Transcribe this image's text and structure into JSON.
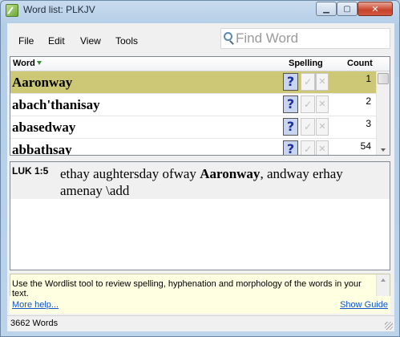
{
  "window": {
    "title": "Word list: PLKJV"
  },
  "menu": {
    "file": "File",
    "edit": "Edit",
    "view": "View",
    "tools": "Tools"
  },
  "search": {
    "placeholder": "Find Word"
  },
  "grid": {
    "headers": {
      "word": "Word",
      "spelling": "Spelling",
      "count": "Count"
    },
    "rows": [
      {
        "word": "Aaronway",
        "count": "1"
      },
      {
        "word": "abach'thanisay",
        "count": "2"
      },
      {
        "word": "abasedway",
        "count": "3"
      },
      {
        "word": "abbathsay",
        "count": "54"
      }
    ],
    "spelling_glyphs": {
      "unknown": "?",
      "ok": "✓",
      "wrong": "✕"
    }
  },
  "context": {
    "reference": "LUK 1:5",
    "text_before": "ethay aughtersday ofway ",
    "highlight": "Aaronway",
    "text_after": ", andway erhay amenay \\add"
  },
  "help": {
    "text": "Use the Wordlist tool to review spelling, hyphenation and morphology of the words in your text.",
    "more_help": "More help...",
    "show_guide": "Show Guide"
  },
  "status": {
    "word_count": "3662 Words"
  },
  "colors": {
    "selected_row": "#ccc875",
    "help_bg": "#ffffe1",
    "link": "#1155cc"
  }
}
